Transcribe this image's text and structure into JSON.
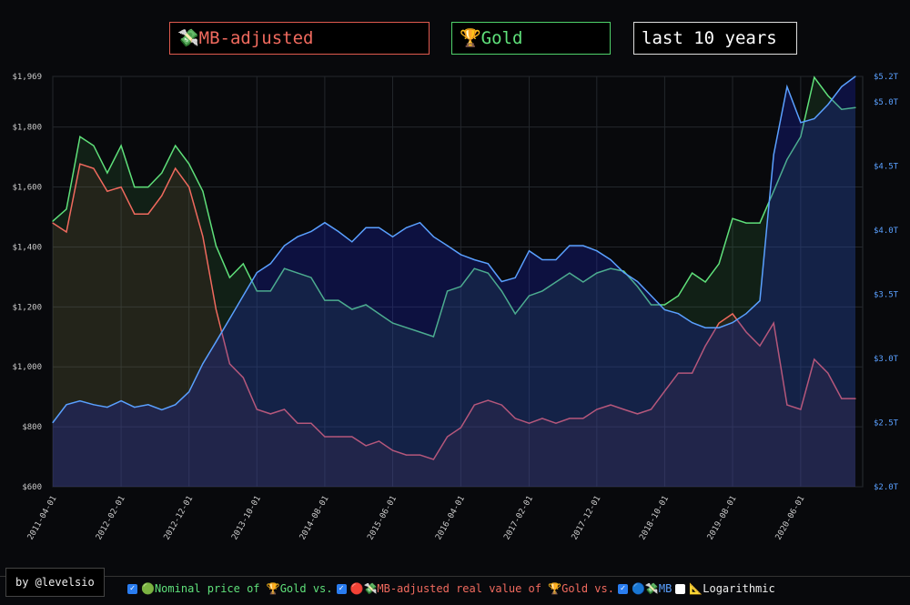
{
  "controls": {
    "series_select": "💸MB-adjusted",
    "asset_select": "🏆Gold",
    "range_select": "last 10 years"
  },
  "credit": "by @levelsio",
  "legend": {
    "nominal": "🟢Nominal price of 🏆Gold vs.",
    "adjusted": "🔴💸MB-adjusted real value of 🏆Gold vs.",
    "mb": "🔵💸MB",
    "log": "📐Logarithmic",
    "nominal_checked": true,
    "adjusted_checked": true,
    "mb_checked": true,
    "log_checked": false
  },
  "colors": {
    "gold": "#5fe07a",
    "adjusted": "#f06a5e",
    "mb": "#5aa0ff"
  },
  "chart_data": {
    "type": "line",
    "grid": true,
    "x": [
      "2011-04-01",
      "2011-06-01",
      "2011-08-01",
      "2011-10-01",
      "2011-12-01",
      "2012-02-01",
      "2012-04-01",
      "2012-06-01",
      "2012-08-01",
      "2012-10-01",
      "2012-12-01",
      "2013-02-01",
      "2013-04-01",
      "2013-06-01",
      "2013-08-01",
      "2013-10-01",
      "2013-12-01",
      "2014-02-01",
      "2014-04-01",
      "2014-06-01",
      "2014-08-01",
      "2014-10-01",
      "2014-12-01",
      "2015-02-01",
      "2015-04-01",
      "2015-06-01",
      "2015-08-01",
      "2015-10-01",
      "2015-12-01",
      "2016-02-01",
      "2016-04-01",
      "2016-06-01",
      "2016-08-01",
      "2016-10-01",
      "2016-12-01",
      "2017-02-01",
      "2017-04-01",
      "2017-06-01",
      "2017-08-01",
      "2017-10-01",
      "2017-12-01",
      "2018-02-01",
      "2018-04-01",
      "2018-06-01",
      "2018-08-01",
      "2018-10-01",
      "2018-12-01",
      "2019-02-01",
      "2019-04-01",
      "2019-06-01",
      "2019-08-01",
      "2019-10-01",
      "2019-12-01",
      "2020-02-01",
      "2020-04-01",
      "2020-06-01",
      "2020-08-01",
      "2020-10-01",
      "2020-12-01",
      "2021-02-01"
    ],
    "x_tick_labels": [
      "2011-04-01",
      "2012-02-01",
      "2012-12-01",
      "2013-10-01",
      "2014-08-01",
      "2015-06-01",
      "2016-04-01",
      "2017-02-01",
      "2017-12-01",
      "2018-10-01",
      "2019-08-01",
      "2020-06-01"
    ],
    "y_left": {
      "range": [
        600,
        1969
      ],
      "ticks": [
        "$600",
        "$800",
        "$1,000",
        "$1,200",
        "$1,400",
        "$1,600",
        "$1,800",
        "$1,969"
      ],
      "tick_values": [
        600,
        800,
        1000,
        1200,
        1400,
        1600,
        1800,
        1969
      ]
    },
    "y_right": {
      "range": [
        2.0,
        5.2
      ],
      "ticks": [
        "$2.0T",
        "$2.5T",
        "$3.0T",
        "$3.5T",
        "$4.0T",
        "$4.5T",
        "$5.0T",
        "$5.2T"
      ],
      "tick_values": [
        2.0,
        2.5,
        3.0,
        3.5,
        4.0,
        4.5,
        5.0,
        5.2
      ]
    },
    "series": [
      {
        "name": "Nominal price of Gold",
        "axis": "left",
        "values": [
          1486,
          1526,
          1768,
          1738,
          1647,
          1738,
          1600,
          1600,
          1647,
          1738,
          1677,
          1586,
          1404,
          1298,
          1344,
          1253,
          1253,
          1328,
          1313,
          1298,
          1222,
          1222,
          1192,
          1207,
          1177,
          1146,
          1131,
          1116,
          1101,
          1253,
          1268,
          1328,
          1313,
          1253,
          1177,
          1237,
          1253,
          1283,
          1313,
          1283,
          1313,
          1328,
          1319,
          1268,
          1207,
          1207,
          1237,
          1313,
          1283,
          1344,
          1495,
          1480,
          1480,
          1586,
          1692,
          1768,
          1966,
          1905,
          1859,
          1865
        ]
      },
      {
        "name": "MB-adjusted real value of Gold",
        "axis": "left",
        "values": [
          1480,
          1450,
          1677,
          1662,
          1586,
          1600,
          1510,
          1510,
          1571,
          1662,
          1600,
          1435,
          1192,
          1010,
          964,
          858,
          843,
          858,
          812,
          812,
          767,
          767,
          767,
          737,
          752,
          721,
          706,
          706,
          691,
          767,
          797,
          873,
          888,
          873,
          828,
          812,
          828,
          812,
          828,
          828,
          858,
          873,
          858,
          843,
          858,
          919,
          979,
          979,
          1070,
          1146,
          1177,
          1116,
          1070,
          1146,
          873,
          858,
          1025,
          979,
          894,
          894
        ]
      },
      {
        "name": "MB",
        "axis": "right",
        "values": [
          2.5,
          2.64,
          2.67,
          2.64,
          2.62,
          2.67,
          2.62,
          2.64,
          2.6,
          2.64,
          2.74,
          2.96,
          3.13,
          3.31,
          3.49,
          3.67,
          3.74,
          3.88,
          3.95,
          3.99,
          4.06,
          3.99,
          3.91,
          4.02,
          4.02,
          3.95,
          4.02,
          4.06,
          3.95,
          3.88,
          3.81,
          3.77,
          3.74,
          3.6,
          3.63,
          3.84,
          3.77,
          3.77,
          3.88,
          3.88,
          3.84,
          3.77,
          3.67,
          3.6,
          3.49,
          3.38,
          3.35,
          3.28,
          3.24,
          3.24,
          3.28,
          3.35,
          3.45,
          4.59,
          5.12,
          4.84,
          4.87,
          4.98,
          5.12,
          5.2
        ]
      }
    ]
  }
}
